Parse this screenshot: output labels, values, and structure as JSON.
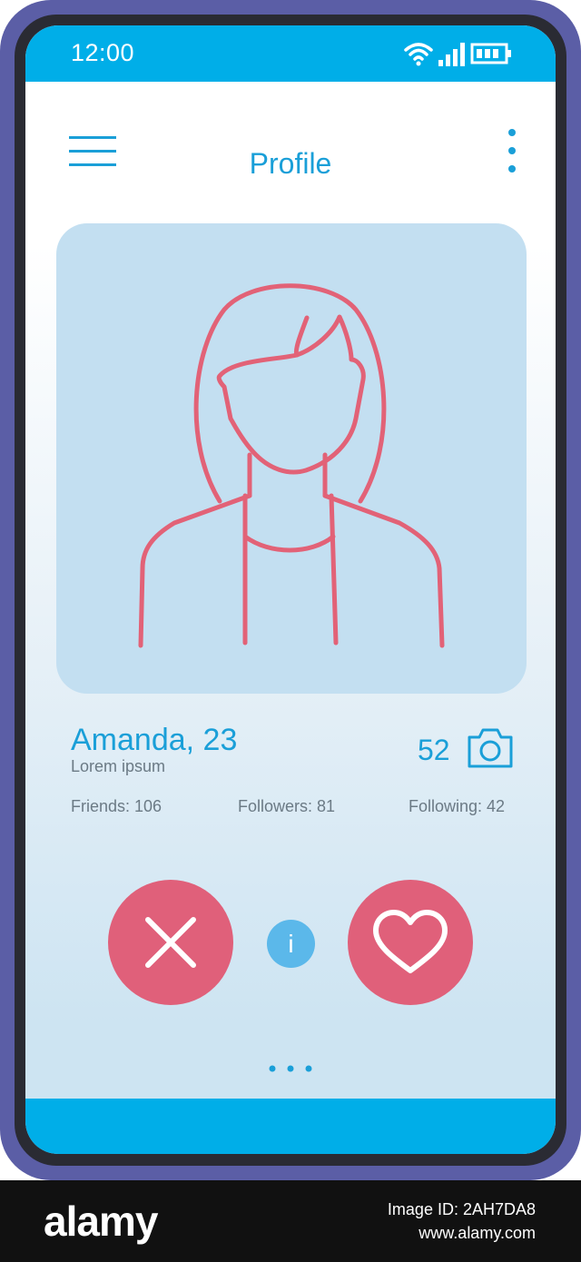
{
  "status_bar": {
    "time": "12:00",
    "icons": [
      "wifi-icon",
      "signal-icon",
      "battery-icon"
    ]
  },
  "header": {
    "title": "Profile",
    "menu_icon": "hamburger-menu-icon",
    "more_icon": "vertical-dots-icon"
  },
  "profile": {
    "photo_icon": "woman-avatar-icon",
    "name_age": "Amanda, 23",
    "subtitle": "Lorem ipsum",
    "photo_count": "52",
    "camera_icon": "camera-icon",
    "stats": {
      "friends": "Friends: 106",
      "followers": "Followers: 81",
      "following": "Following: 42"
    }
  },
  "actions": {
    "dislike_icon": "close-icon",
    "info_label": "i",
    "like_icon": "heart-icon"
  },
  "pager": {
    "dots": 3
  },
  "watermark": {
    "logo": "alamy",
    "image_id": "Image ID: 2AH7DA8",
    "site": "www.alamy.com"
  },
  "colors": {
    "accent_blue": "#00aee8",
    "title_blue": "#1a9fd8",
    "action_pink": "#e0607a",
    "card_blue": "#c3dff1",
    "frame_purple": "#5b5ea6",
    "info_blue": "#5bb8ea"
  }
}
